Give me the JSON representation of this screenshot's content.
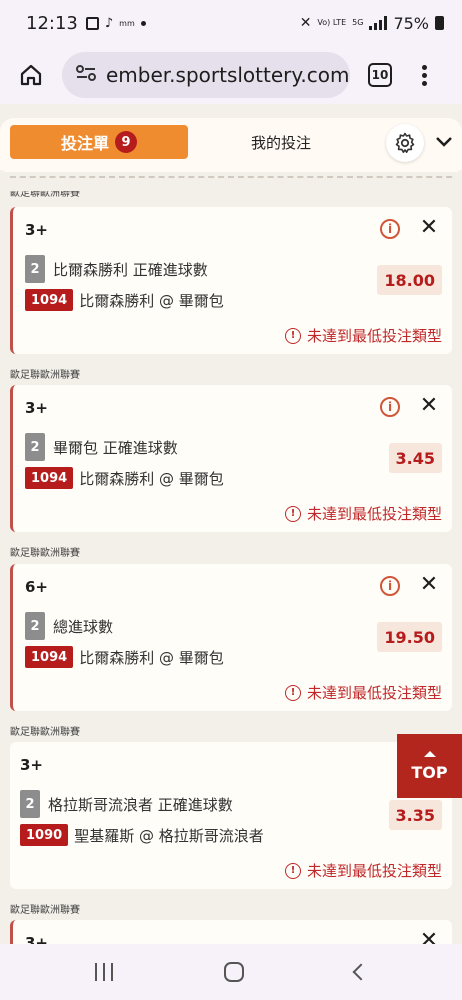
{
  "status_bar": {
    "time": "12:13",
    "signal_text": "Vo) LTE",
    "network": "5G",
    "battery": "75%"
  },
  "browser": {
    "url": "ember.sportslottery.com.tw",
    "tab_count": "10"
  },
  "header": {
    "betslip_label": "投注單",
    "betslip_count": "9",
    "mybets_label": "我的投注"
  },
  "league_top_clipped": "歐足聯歐洲聯賽",
  "bets": [
    {
      "league": "",
      "bet_type": "3+",
      "selection_num": "2",
      "selection": "比爾森勝利 正確進球數",
      "match_code": "1094",
      "match": "比爾森勝利 @ 畢爾包",
      "odds": "18.00",
      "warning": "未達到最低投注類型"
    },
    {
      "league": "歐足聯歐洲聯賽",
      "bet_type": "3+",
      "selection_num": "2",
      "selection": "畢爾包 正確進球數",
      "match_code": "1094",
      "match": "比爾森勝利 @ 畢爾包",
      "odds": "3.45",
      "warning": "未達到最低投注類型"
    },
    {
      "league": "歐足聯歐洲聯賽",
      "bet_type": "6+",
      "selection_num": "2",
      "selection": "總進球數",
      "match_code": "1094",
      "match": "比爾森勝利 @ 畢爾包",
      "odds": "19.50",
      "warning": "未達到最低投注類型"
    },
    {
      "league": "歐足聯歐洲聯賽",
      "bet_type": "3+",
      "selection_num": "2",
      "selection": "格拉斯哥流浪者 正確進球數",
      "match_code": "1090",
      "match": "聖基羅斯 @ 格拉斯哥流浪者",
      "odds": "3.35",
      "warning": "未達到最低投注類型"
    }
  ],
  "league_bottom": "歐足聯歐洲聯賽",
  "partial_bet_type": "3+",
  "top_button": "TOP",
  "colors": {
    "accent_orange": "#ef8c30",
    "badge_red": "#b71c1c",
    "warning_red": "#c0282a",
    "top_red": "#b3261e"
  }
}
